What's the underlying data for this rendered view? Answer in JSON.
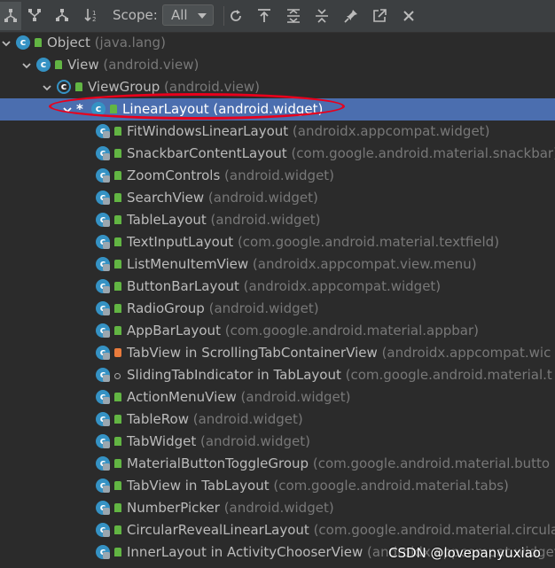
{
  "toolbar": {
    "scope_label": "Scope:",
    "scope_value": "All",
    "buttons": [
      "subtypes-hierarchy",
      "supertypes-hierarchy",
      "class-hierarchy",
      "sort-alphabetically",
      "refresh",
      "export",
      "expand-all",
      "collapse-all",
      "pin",
      "open-in-new-tab",
      "close"
    ]
  },
  "tree": [
    {
      "name": "Object",
      "pkg": "(java.lang)",
      "icon": "class",
      "visibility": "public",
      "expanded": true
    },
    {
      "name": "View",
      "pkg": "(android.view)",
      "icon": "class",
      "visibility": "public",
      "expanded": true
    },
    {
      "name": "ViewGroup",
      "pkg": "(android.view)",
      "icon": "abstract-class",
      "visibility": "public",
      "expanded": true
    },
    {
      "name": "LinearLayout",
      "pkg": "(android.widget)",
      "icon": "class",
      "visibility": "public",
      "expanded": true,
      "selected": true,
      "marker": "*"
    },
    {
      "name": "FitWindowsLinearLayout",
      "pkg": "(androidx.appcompat.widget)",
      "icon": "class",
      "visibility": "public"
    },
    {
      "name": "SnackbarContentLayout",
      "pkg": "(com.google.android.material.snackbar)",
      "icon": "class",
      "visibility": "public"
    },
    {
      "name": "ZoomControls",
      "pkg": "(android.widget)",
      "icon": "class",
      "visibility": "public"
    },
    {
      "name": "SearchView",
      "pkg": "(android.widget)",
      "icon": "class",
      "visibility": "public"
    },
    {
      "name": "TableLayout",
      "pkg": "(android.widget)",
      "icon": "class",
      "visibility": "public"
    },
    {
      "name": "TextInputLayout",
      "pkg": "(com.google.android.material.textfield)",
      "icon": "class",
      "visibility": "public"
    },
    {
      "name": "ListMenuItemView",
      "pkg": "(androidx.appcompat.view.menu)",
      "icon": "class",
      "visibility": "public"
    },
    {
      "name": "ButtonBarLayout",
      "pkg": "(androidx.appcompat.widget)",
      "icon": "class",
      "visibility": "public"
    },
    {
      "name": "RadioGroup",
      "pkg": "(android.widget)",
      "icon": "class",
      "visibility": "public"
    },
    {
      "name": "AppBarLayout",
      "pkg": "(com.google.android.material.appbar)",
      "icon": "class",
      "visibility": "public"
    },
    {
      "name": "TabView in ScrollingTabContainerView",
      "pkg": "(androidx.appcompat.wic",
      "icon": "class",
      "visibility": "private"
    },
    {
      "name": "SlidingTabIndicator in TabLayout",
      "pkg": "(com.google.android.material.t",
      "icon": "class",
      "visibility": "package"
    },
    {
      "name": "ActionMenuView",
      "pkg": "(android.widget)",
      "icon": "class",
      "visibility": "public"
    },
    {
      "name": "TableRow",
      "pkg": "(android.widget)",
      "icon": "class",
      "visibility": "public"
    },
    {
      "name": "TabWidget",
      "pkg": "(android.widget)",
      "icon": "class",
      "visibility": "public"
    },
    {
      "name": "MaterialButtonToggleGroup",
      "pkg": "(com.google.android.material.butto",
      "icon": "class",
      "visibility": "public"
    },
    {
      "name": "TabView in TabLayout",
      "pkg": "(com.google.android.material.tabs)",
      "icon": "class",
      "visibility": "public"
    },
    {
      "name": "NumberPicker",
      "pkg": "(android.widget)",
      "icon": "class",
      "visibility": "public"
    },
    {
      "name": "CircularRevealLinearLayout",
      "pkg": "(com.google.android.material.circula",
      "icon": "class",
      "visibility": "public"
    },
    {
      "name": "InnerLayout in ActivityChooserView",
      "pkg": "(androidx.appcompat.widget)",
      "icon": "class",
      "visibility": "public"
    }
  ],
  "watermark": "CSDN @lovepanyuxiao",
  "colors": {
    "background": "#2b2b2b",
    "selection": "#4b6eaf",
    "class_icon": "#3592c4",
    "annotation": "#e8001c"
  }
}
